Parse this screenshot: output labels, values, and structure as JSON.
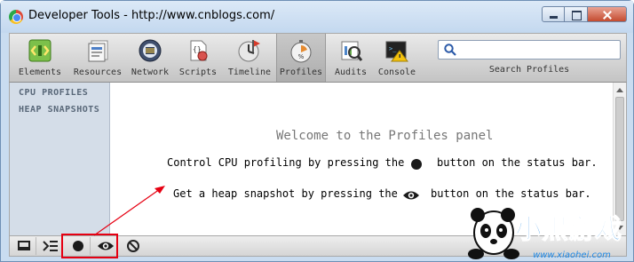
{
  "window": {
    "title": "Developer Tools - http://www.cnblogs.com/"
  },
  "toolbar": {
    "tools": [
      {
        "label": "Elements",
        "icon": "elements-icon"
      },
      {
        "label": "Resources",
        "icon": "resources-icon"
      },
      {
        "label": "Network",
        "icon": "network-icon"
      },
      {
        "label": "Scripts",
        "icon": "scripts-icon"
      },
      {
        "label": "Timeline",
        "icon": "timeline-icon"
      },
      {
        "label": "Profiles",
        "icon": "profiles-icon",
        "selected": true
      },
      {
        "label": "Audits",
        "icon": "audits-icon"
      },
      {
        "label": "Console",
        "icon": "console-icon"
      }
    ],
    "search": {
      "value": "",
      "label": "Search Profiles"
    }
  },
  "sidebar": {
    "items": [
      {
        "label": "CPU PROFILES"
      },
      {
        "label": "HEAP SNAPSHOTS"
      }
    ]
  },
  "main": {
    "welcome": "Welcome to the Profiles panel",
    "cpu_line_before": "Control CPU profiling by pressing the",
    "cpu_line_after": "button on the status bar.",
    "heap_line_before": "Get a heap snapshot by pressing the",
    "heap_line_after": "button on the status bar."
  },
  "statusbar": {
    "buttons": [
      "dock-icon",
      "console-toggle-icon",
      "record-icon",
      "heap-snapshot-eye-icon",
      "clear-icon"
    ]
  },
  "watermark": {
    "text": "小黑游戏",
    "url": "www.xiaohei.com"
  },
  "colors": {
    "annotation": "#e60012",
    "sidebar_bg": "#d4dde8",
    "frame": "#c9dcf0"
  }
}
